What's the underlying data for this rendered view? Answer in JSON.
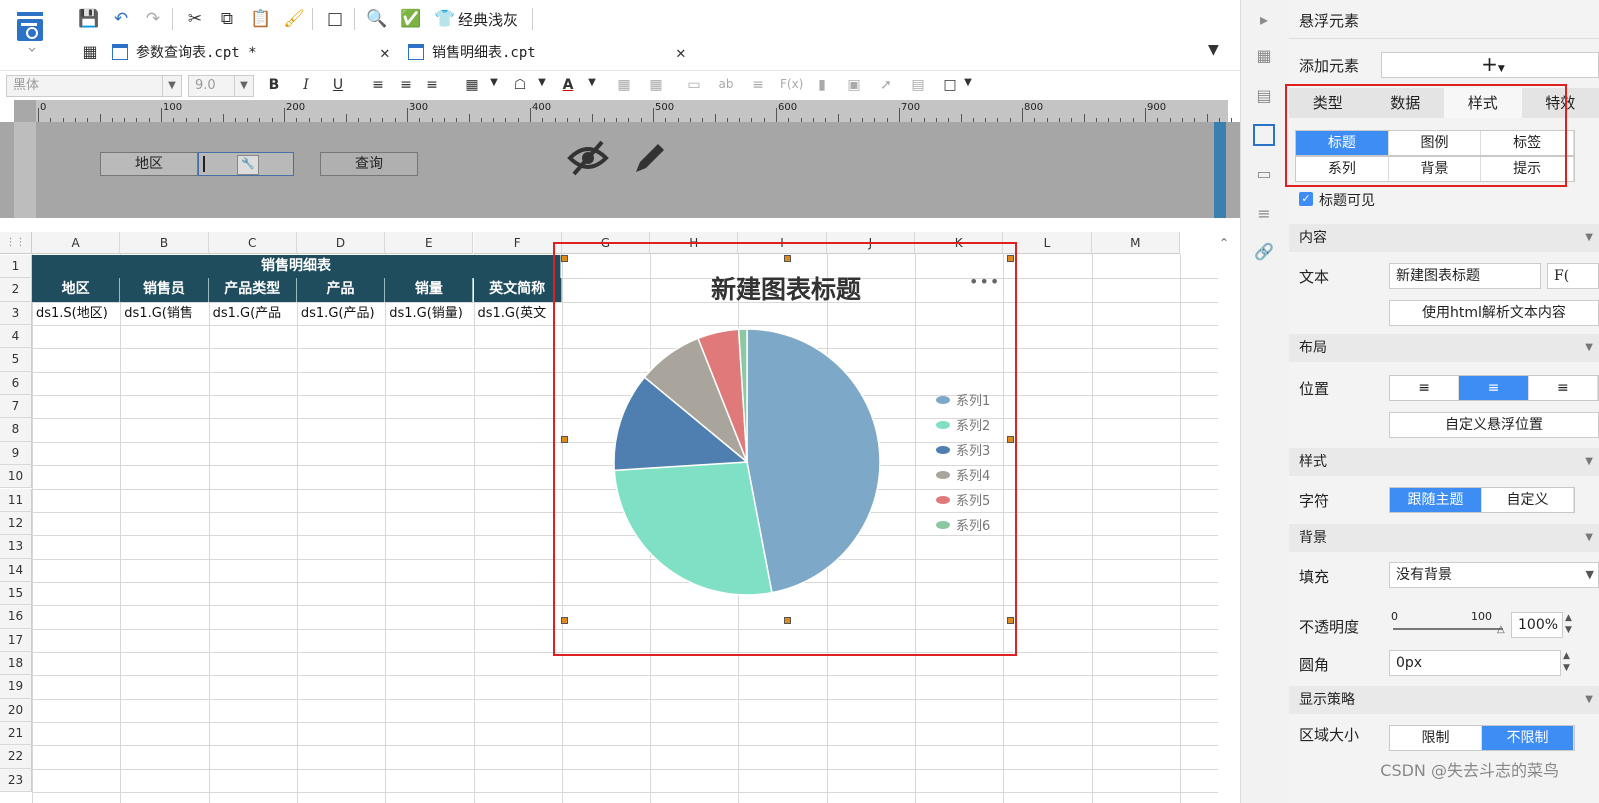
{
  "toolbar": {
    "theme_label": "经典浅灰"
  },
  "tabs": [
    {
      "label": "参数查询表.cpt *"
    },
    {
      "label": "销售明细表.cpt"
    }
  ],
  "format_bar": {
    "font_name": "黑体",
    "font_size": "9.0"
  },
  "ruler": {
    "marks": [
      "0",
      "100",
      "200",
      "300",
      "400",
      "500",
      "600",
      "700",
      "800",
      "900"
    ]
  },
  "param_panel": {
    "region_label": "地区",
    "query_button": "查询"
  },
  "grid": {
    "columns": [
      "A",
      "B",
      "C",
      "D",
      "E",
      "F",
      "G",
      "H",
      "I",
      "J",
      "K",
      "L",
      "M"
    ],
    "rows": [
      "1",
      "2",
      "3",
      "4",
      "5",
      "6",
      "7",
      "8",
      "9",
      "10",
      "11",
      "12",
      "13",
      "14",
      "15",
      "16",
      "17",
      "18",
      "19",
      "20",
      "21",
      "22",
      "23"
    ],
    "title_cell": "销售明细表",
    "headers": [
      "地区",
      "销售员",
      "产品类型",
      "产品",
      "销量",
      "英文简称"
    ],
    "formula_cells": [
      "ds1.S(地区)",
      "ds1.G(销售",
      "ds1.G(产品",
      "ds1.G(产品)",
      "ds1.G(销量)",
      "ds1.G(英文"
    ],
    "header_bg": "#1f4d5e"
  },
  "chart": {
    "more_icon": "more-icon"
  },
  "chart_data": {
    "type": "pie",
    "title": "新建图表标题",
    "legend_position": "right",
    "categories": [
      "系列1",
      "系列2",
      "系列3",
      "系列4",
      "系列5",
      "系列6"
    ],
    "values": [
      47,
      27,
      12,
      8,
      5,
      1
    ],
    "colors": [
      "#7ea8c8",
      "#7fe0c6",
      "#4f7fb0",
      "#aaa59c",
      "#e07a7a",
      "#8bc7a0"
    ]
  },
  "right_panel": {
    "title": "悬浮元素",
    "add_element_label": "添加元素",
    "tabs": [
      "类型",
      "数据",
      "样式",
      "特效"
    ],
    "active_tab": "样式",
    "subtabs": [
      "标题",
      "图例",
      "标签",
      "系列",
      "背景",
      "提示"
    ],
    "active_subtab": "标题",
    "title_visible_label": "标题可见",
    "content_section": "内容",
    "text_label": "文本",
    "text_value": "新建图表标题",
    "fx_label": "F(",
    "html_parse_button": "使用html解析文本内容",
    "layout_section": "布局",
    "position_label": "位置",
    "custom_float_button": "自定义悬浮位置",
    "style_section": "样式",
    "char_label": "字符",
    "char_options": [
      "跟随主题",
      "自定义"
    ],
    "bg_section": "背景",
    "fill_label": "填充",
    "fill_value": "没有背景",
    "opacity_label": "不透明度",
    "opacity_min": "0",
    "opacity_max": "100",
    "opacity_value": "100%",
    "radius_label": "圆角",
    "radius_value": "0px",
    "display_section": "显示策略",
    "area_label": "区域大小",
    "area_options": [
      "限制",
      "不限制"
    ],
    "accent": "#3d8df5"
  },
  "watermark": "CSDN @失去斗志的菜鸟"
}
